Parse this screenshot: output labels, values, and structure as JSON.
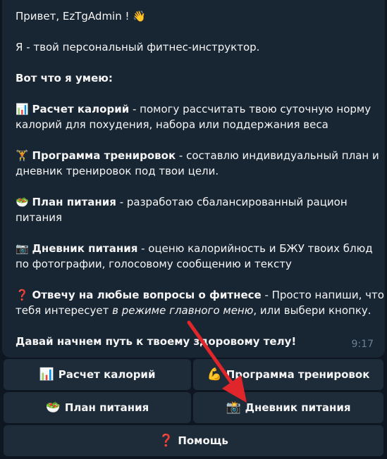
{
  "message": {
    "greeting": "Привет, EzTgAdmin ! 👋",
    "intro": "Я - твой персональный фитнес-инструктор.",
    "skills_title": "Вот что я умею:",
    "items": [
      {
        "icon": "📊",
        "title": "Расчет калорий",
        "line1": " - помогу рассчитать твою суточную норму",
        "line2": "калорий для похудения, набора или поддержания веса"
      },
      {
        "icon": "🏋️",
        "title": "Программа тренировок",
        "line1": " - составлю индивидуальный план и",
        "line2": "дневник тренировок под твои цели."
      },
      {
        "icon": "🥗",
        "title": "План питания",
        "line1": " - разработаю сбалансированный рацион",
        "line2": "питания"
      },
      {
        "icon": "📷",
        "title": "Дневник питания",
        "line1": " - оценю калорийность и БЖУ твоих блюд",
        "line2": "по фотографии, голосовому сообщению и тексту"
      }
    ],
    "faq": {
      "icon": "❓",
      "title": "Отвечу на любые вопросы о фитнесе",
      "line1": " - Просто напиши, что",
      "line2_pre": "тебя интересует ",
      "line2_italic": "в режиме главного меню",
      "line2_post": ", или выбери кнопку."
    },
    "closing": "Давай начнем путь к твоему здоровому телу!",
    "time": "9:17"
  },
  "keyboard": {
    "calories": {
      "icon": "📊",
      "label": "Расчет калорий"
    },
    "training": {
      "icon": "💪",
      "label": "Программа тренировок"
    },
    "meal_plan": {
      "icon": "🥗",
      "label": "План питания"
    },
    "food_diary": {
      "icon": "📸",
      "label": "Дневник питания"
    },
    "help": {
      "icon": "❓",
      "label": "Помощь"
    }
  },
  "colors": {
    "background": "#0e1621",
    "bubble": "#182533",
    "button": "#1e2c3a",
    "arrow": "#e0262b",
    "time": "#6d8194"
  }
}
